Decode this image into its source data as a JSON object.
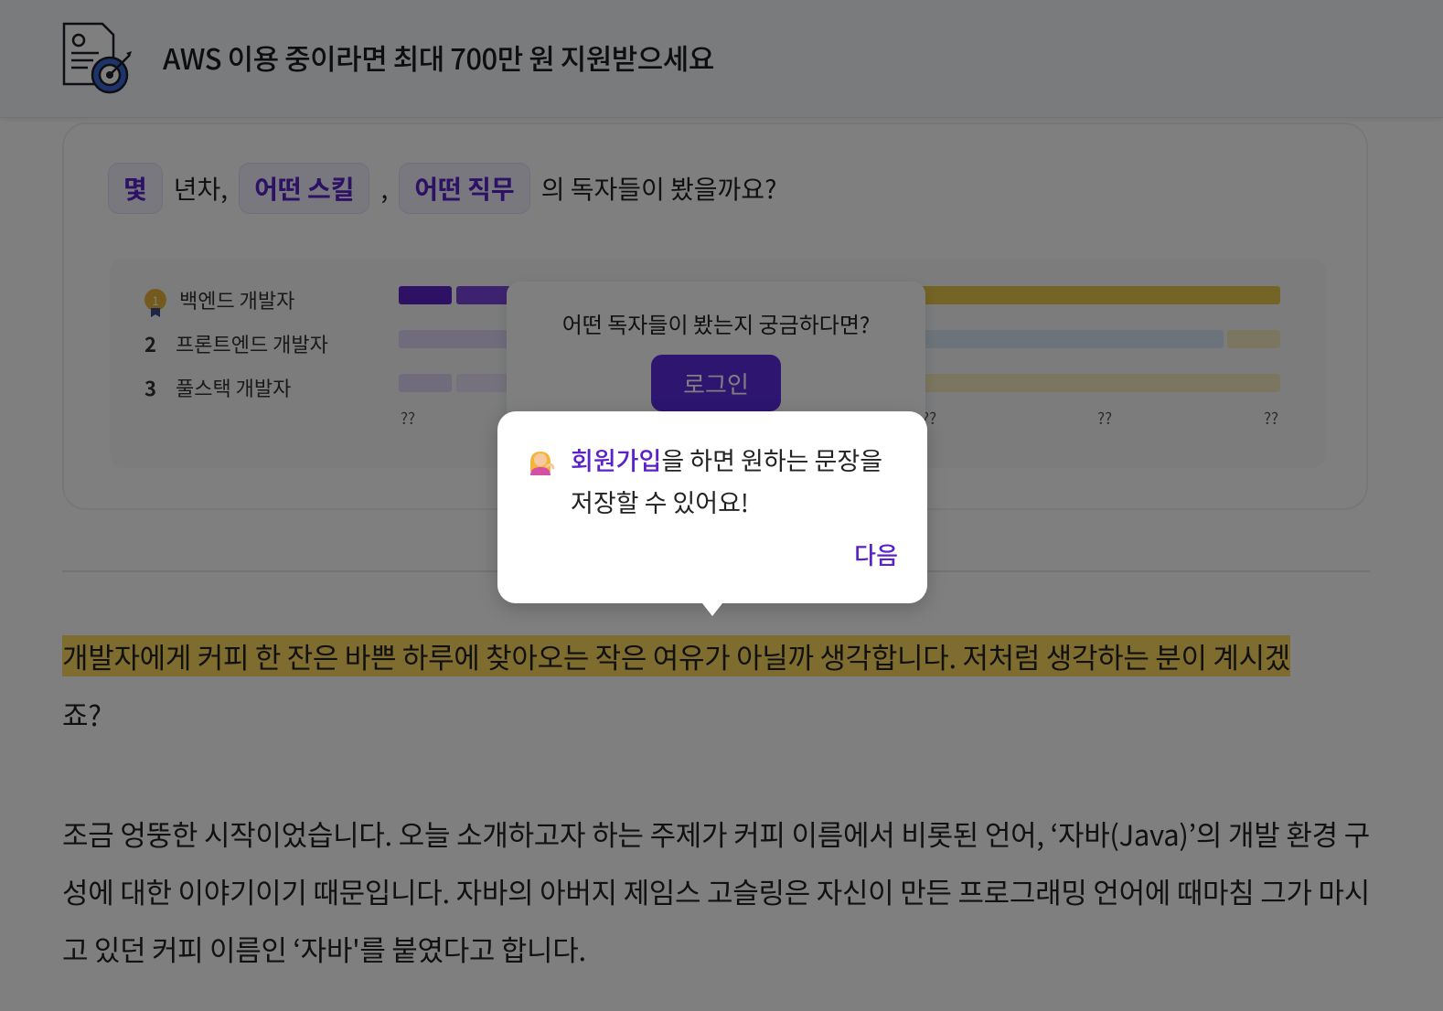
{
  "banner": {
    "title": "AWS 이용 중이라면 최대 700만 원 지원받으세요",
    "icon": "document-target-icon"
  },
  "stats_card": {
    "chip_years": "몇",
    "text_years": "년차,",
    "chip_skill": "어떤 스킬",
    "comma": ",",
    "chip_job": "어떤 직무",
    "text_suffix": "의  독자들이 봤을까요?",
    "ranks": [
      {
        "num": "1",
        "label": "백엔드 개발자"
      },
      {
        "num": "2",
        "label": "프론트엔드 개발자"
      },
      {
        "num": "3",
        "label": "풀스택 개발자"
      }
    ],
    "ticks": [
      "??",
      "??",
      "??",
      "??"
    ],
    "colors": {
      "purple": "#5a22c8",
      "yellow": "#e8c84b",
      "blue": "#b9d4ec"
    }
  },
  "login_box": {
    "question": "어떤 독자들이 봤는지 궁금하다면?",
    "button": "로그인"
  },
  "tooltip": {
    "emoji": "person-tipping-hand-icon",
    "link_text": "회원가입",
    "text_rest": "을 하면 원하는 문장을 저장할 수 있어요!",
    "next": "다음"
  },
  "article": {
    "highlighted": "개발자에게 커피 한 잔은 바쁜 하루에 찾아오는 작은 여유가 아닐까 생각합니다. 저처럼 생각하는 분이 계시겠",
    "highlight_tail": "죠?",
    "para2": "조금 엉뚱한 시작이었습니다. 오늘 소개하고자 하는 주제가 커피 이름에서 비롯된 언어, ‘자바(Java)’의 개발 환경 구성에 대한 이야기이기 때문입니다. 자바의 아버지 제임스 고슬링은 자신이 만든 프로그래밍 언어에 때마침 그가 마시고 있던 커피 이름인 ‘자바'를 붙였다고 합니다."
  }
}
